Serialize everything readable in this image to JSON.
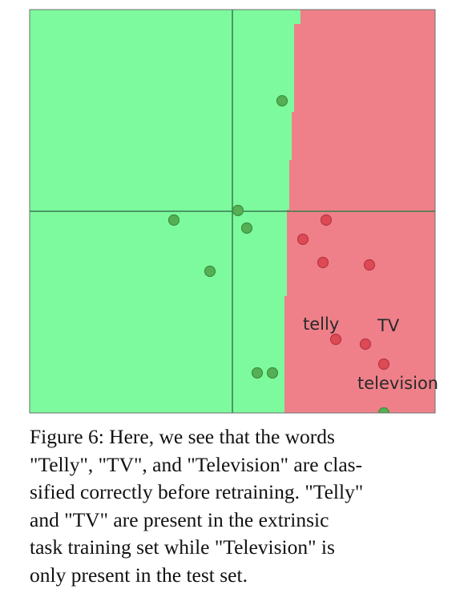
{
  "figure": {
    "colors": {
      "green_region": "#7dfa9d",
      "red_region": "#ef8089",
      "green_point": "#55b055",
      "red_point": "#dd4a55",
      "axis": "#3a7a50",
      "border": "#6f6f6f"
    },
    "green_points": [
      {
        "name": "green-point-1"
      },
      {
        "name": "green-point-2"
      },
      {
        "name": "green-point-3"
      },
      {
        "name": "green-point-4"
      },
      {
        "name": "green-point-5"
      },
      {
        "name": "green-point-6"
      },
      {
        "name": "green-point-7"
      },
      {
        "name": "green-point-8"
      }
    ],
    "red_points": [
      {
        "name": "red-point-1"
      },
      {
        "name": "red-point-2"
      },
      {
        "name": "red-point-3"
      },
      {
        "name": "red-point-4"
      },
      {
        "name": "red-point-telly"
      },
      {
        "name": "red-point-tv"
      },
      {
        "name": "red-point-television"
      }
    ],
    "labels": {
      "telly": "telly",
      "tv": "TV",
      "television": "television"
    }
  },
  "caption": {
    "lines": [
      "Figure 6: Here, we see that the words",
      "\"Telly\", \"TV\", and \"Television\" are clas-",
      "sified correctly before retraining. \"Telly\"",
      "and \"TV\" are present in the extrinsic",
      "task training set while \"Television\" is",
      "only present in the test set."
    ]
  }
}
